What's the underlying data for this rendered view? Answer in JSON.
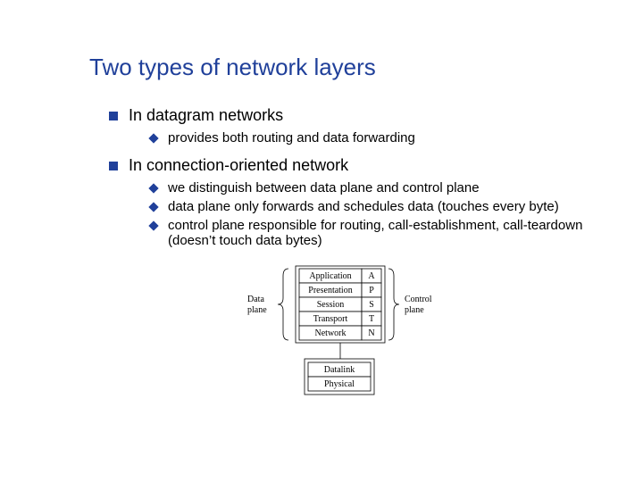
{
  "title": "Two types of network layers",
  "bullets": {
    "b1": "In datagram networks",
    "b1_1": "provides both routing and data forwarding",
    "b2": "In connection-oriented network",
    "b2_1": "we distinguish between data plane and control plane",
    "b2_2": "data plane only forwards and schedules data (touches every byte)",
    "b2_3": "control plane responsible for routing, call-establishment, call-teardown (doesn’t touch data bytes)"
  },
  "diagram": {
    "left_label": "Data\nplane",
    "right_label": "Control\nplane",
    "upper_layers": [
      "Application",
      "Presentation",
      "Session",
      "Transport",
      "Network"
    ],
    "upper_letters": [
      "A",
      "P",
      "S",
      "T",
      "N"
    ],
    "lower_layers": [
      "Datalink",
      "Physical"
    ]
  }
}
